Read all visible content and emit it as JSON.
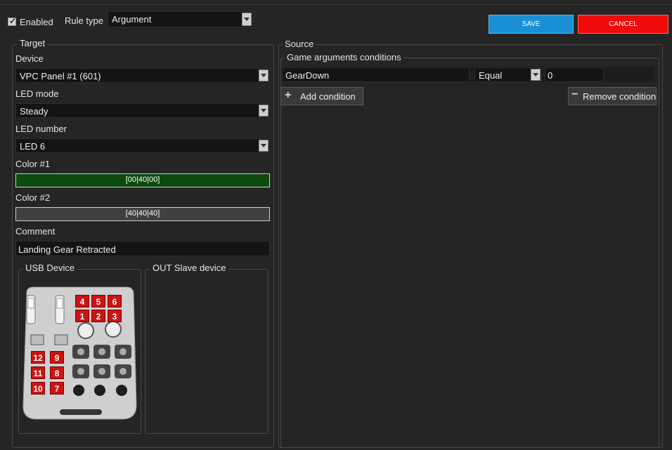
{
  "header": {
    "enabled_label": "Enabled",
    "enabled_checked": true,
    "rule_type_label": "Rule type",
    "rule_type_value": "Argument",
    "save_label": "SAVE",
    "cancel_label": "CANCEL"
  },
  "target": {
    "title": "Target",
    "device_label": "Device",
    "device_value": "VPC Panel #1 (601)",
    "led_mode_label": "LED mode",
    "led_mode_value": "Steady",
    "led_number_label": "LED number",
    "led_number_value": "LED 6",
    "color1_label": "Color #1",
    "color1_value": "[00|40|00]",
    "color1_hex": "#0d4a0d",
    "color2_label": "Color #2",
    "color2_value": "[40|40|40]",
    "color2_hex": "#404040",
    "comment_label": "Comment",
    "comment_value": "Landing Gear Retracted",
    "usb_device_title": "USB Device",
    "out_slave_title": "OUT Slave device",
    "device_pads": [
      "4",
      "5",
      "6",
      "1",
      "2",
      "3",
      "12",
      "9",
      "11",
      "8",
      "10",
      "7"
    ]
  },
  "source": {
    "title": "Source",
    "conditions_title": "Game arguments conditions",
    "conditions": [
      {
        "argument": "GearDown",
        "operator": "Equal",
        "value": "0"
      }
    ],
    "add_condition_label": "Add condition",
    "remove_condition_label": "Remove condition"
  },
  "colors": {
    "save": "#1a8fd6",
    "cancel": "#f00a0a",
    "background": "#252525",
    "led_red": "#cc1313"
  }
}
